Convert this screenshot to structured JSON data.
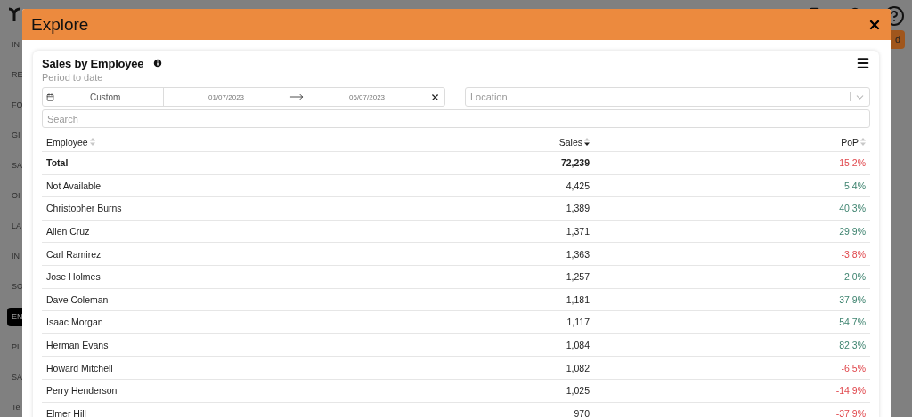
{
  "background": {
    "sidebar": [
      {
        "label": "IN",
        "selected": false
      },
      {
        "label": "RE",
        "selected": false
      },
      {
        "label": "FO",
        "selected": false
      },
      {
        "label": "GI",
        "selected": false
      },
      {
        "label": "SA",
        "selected": false
      },
      {
        "label": "OI",
        "selected": false
      },
      {
        "label": "LA",
        "selected": false
      },
      {
        "label": "IN",
        "selected": false
      },
      {
        "label": "SO",
        "selected": false
      },
      {
        "label": "EN",
        "selected": true
      },
      {
        "label": "PL",
        "selected": false
      },
      {
        "label": "SA",
        "selected": false
      },
      {
        "label": "Te",
        "selected": false
      }
    ],
    "header_button": "d"
  },
  "modal": {
    "title": "Explore",
    "card": {
      "title": "Sales by Employee",
      "subtitle": "Period to date",
      "period": {
        "preset": "Custom",
        "start": "01/07/2023",
        "end": "06/07/2023"
      },
      "location": {
        "placeholder": "Location"
      },
      "search": {
        "placeholder": "Search"
      },
      "table": {
        "columns": [
          {
            "label": "Employee",
            "sorted": false
          },
          {
            "label": "Sales",
            "sorted": true
          },
          {
            "label": "PoP",
            "sorted": false
          }
        ],
        "rows": [
          {
            "employee": "Total",
            "sales": "72,239",
            "pop": "-15.2%",
            "negative": true,
            "kind": "total"
          },
          {
            "employee": "Not Available",
            "sales": "4,425",
            "pop": "5.4%",
            "negative": false,
            "kind": "row"
          },
          {
            "employee": "Christopher Burns",
            "sales": "1,389",
            "pop": "40.3%",
            "negative": false,
            "kind": "row"
          },
          {
            "employee": "Allen Cruz",
            "sales": "1,371",
            "pop": "29.9%",
            "negative": false,
            "kind": "row"
          },
          {
            "employee": "Carl Ramirez",
            "sales": "1,363",
            "pop": "-3.8%",
            "negative": true,
            "kind": "row"
          },
          {
            "employee": "Jose Holmes",
            "sales": "1,257",
            "pop": "2.0%",
            "negative": false,
            "kind": "row"
          },
          {
            "employee": "Dave Coleman",
            "sales": "1,181",
            "pop": "37.9%",
            "negative": false,
            "kind": "row"
          },
          {
            "employee": "Isaac Morgan",
            "sales": "1,117",
            "pop": "54.7%",
            "negative": false,
            "kind": "row"
          },
          {
            "employee": "Herman Evans",
            "sales": "1,084",
            "pop": "82.3%",
            "negative": false,
            "kind": "row"
          },
          {
            "employee": "Howard Mitchell",
            "sales": "1,082",
            "pop": "-6.5%",
            "negative": true,
            "kind": "row"
          },
          {
            "employee": "Perry Henderson",
            "sales": "1,025",
            "pop": "-14.9%",
            "negative": true,
            "kind": "row"
          },
          {
            "employee": "Elmer Hill",
            "sales": "970",
            "pop": "-37.9%",
            "negative": true,
            "kind": "row"
          }
        ]
      }
    }
  }
}
